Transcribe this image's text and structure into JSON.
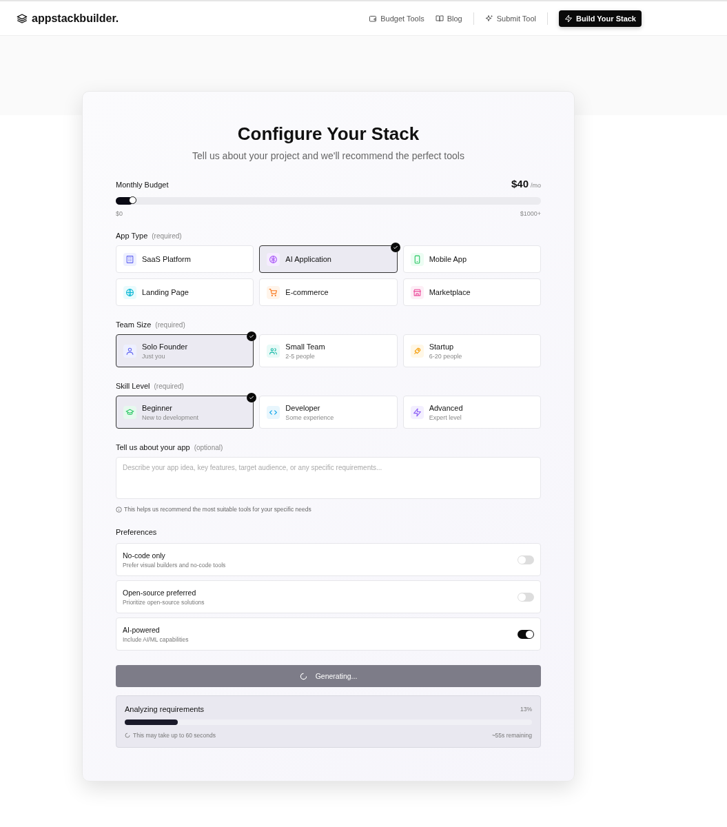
{
  "header": {
    "logo": "appstackbuilder.",
    "nav": [
      {
        "label": "Budget Tools",
        "kind": "wallet"
      },
      {
        "label": "Blog",
        "kind": "book"
      },
      {
        "label": "Submit Tool",
        "kind": "sparkle"
      }
    ],
    "cta": "Build Your Stack"
  },
  "form": {
    "title": "Configure Your Stack",
    "subtitle": "Tell us about your project and we'll recommend the perfect tools",
    "budget": {
      "label": "Monthly Budget",
      "value": "$40",
      "unit": "/mo",
      "level": 0.04,
      "min": "$0",
      "max": "$1000+"
    },
    "app_type": {
      "label": "App Type",
      "note": "(required)",
      "options": [
        {
          "label": "SaaS Platform",
          "selected": false
        },
        {
          "label": "AI Application",
          "selected": true
        },
        {
          "label": "Mobile App",
          "selected": false
        },
        {
          "label": "Landing Page",
          "selected": false
        },
        {
          "label": "E-commerce",
          "selected": false
        },
        {
          "label": "Marketplace",
          "selected": false
        }
      ]
    },
    "team_size": {
      "label": "Team Size",
      "note": "(required)",
      "options": [
        {
          "label": "Solo Founder",
          "sub": "Just you",
          "selected": true
        },
        {
          "label": "Small Team",
          "sub": "2-5 people",
          "selected": false
        },
        {
          "label": "Startup",
          "sub": "6-20 people",
          "selected": false
        }
      ]
    },
    "skill_level": {
      "label": "Skill Level",
      "note": "(required)",
      "options": [
        {
          "label": "Beginner",
          "sub": "New to development",
          "selected": true
        },
        {
          "label": "Developer",
          "sub": "Some experience",
          "selected": false
        },
        {
          "label": "Advanced",
          "sub": "Expert level",
          "selected": false
        }
      ]
    },
    "description": {
      "label": "Tell us about your app",
      "note": "(optional)",
      "placeholder": "Describe your app idea, key features, target audience, or any specific requirements...",
      "hint": "This helps us recommend the most suitable tools for your specific needs"
    },
    "preferences": {
      "label": "Preferences",
      "items": [
        {
          "title": "No-code only",
          "sub": "Prefer visual builders and no-code tools",
          "on": false
        },
        {
          "title": "Open-source preferred",
          "sub": "Prioritize open-source solutions",
          "on": false
        },
        {
          "title": "AI-powered",
          "sub": "Include AI/ML capabilities",
          "on": true
        }
      ]
    },
    "submit": {
      "label": "Generating...",
      "disabled": true
    },
    "progress": {
      "title": "Analyzing requirements",
      "percent": "13%",
      "level": 0.13,
      "note": "This may take up to 60 seconds",
      "remaining": "~55s remaining"
    }
  }
}
